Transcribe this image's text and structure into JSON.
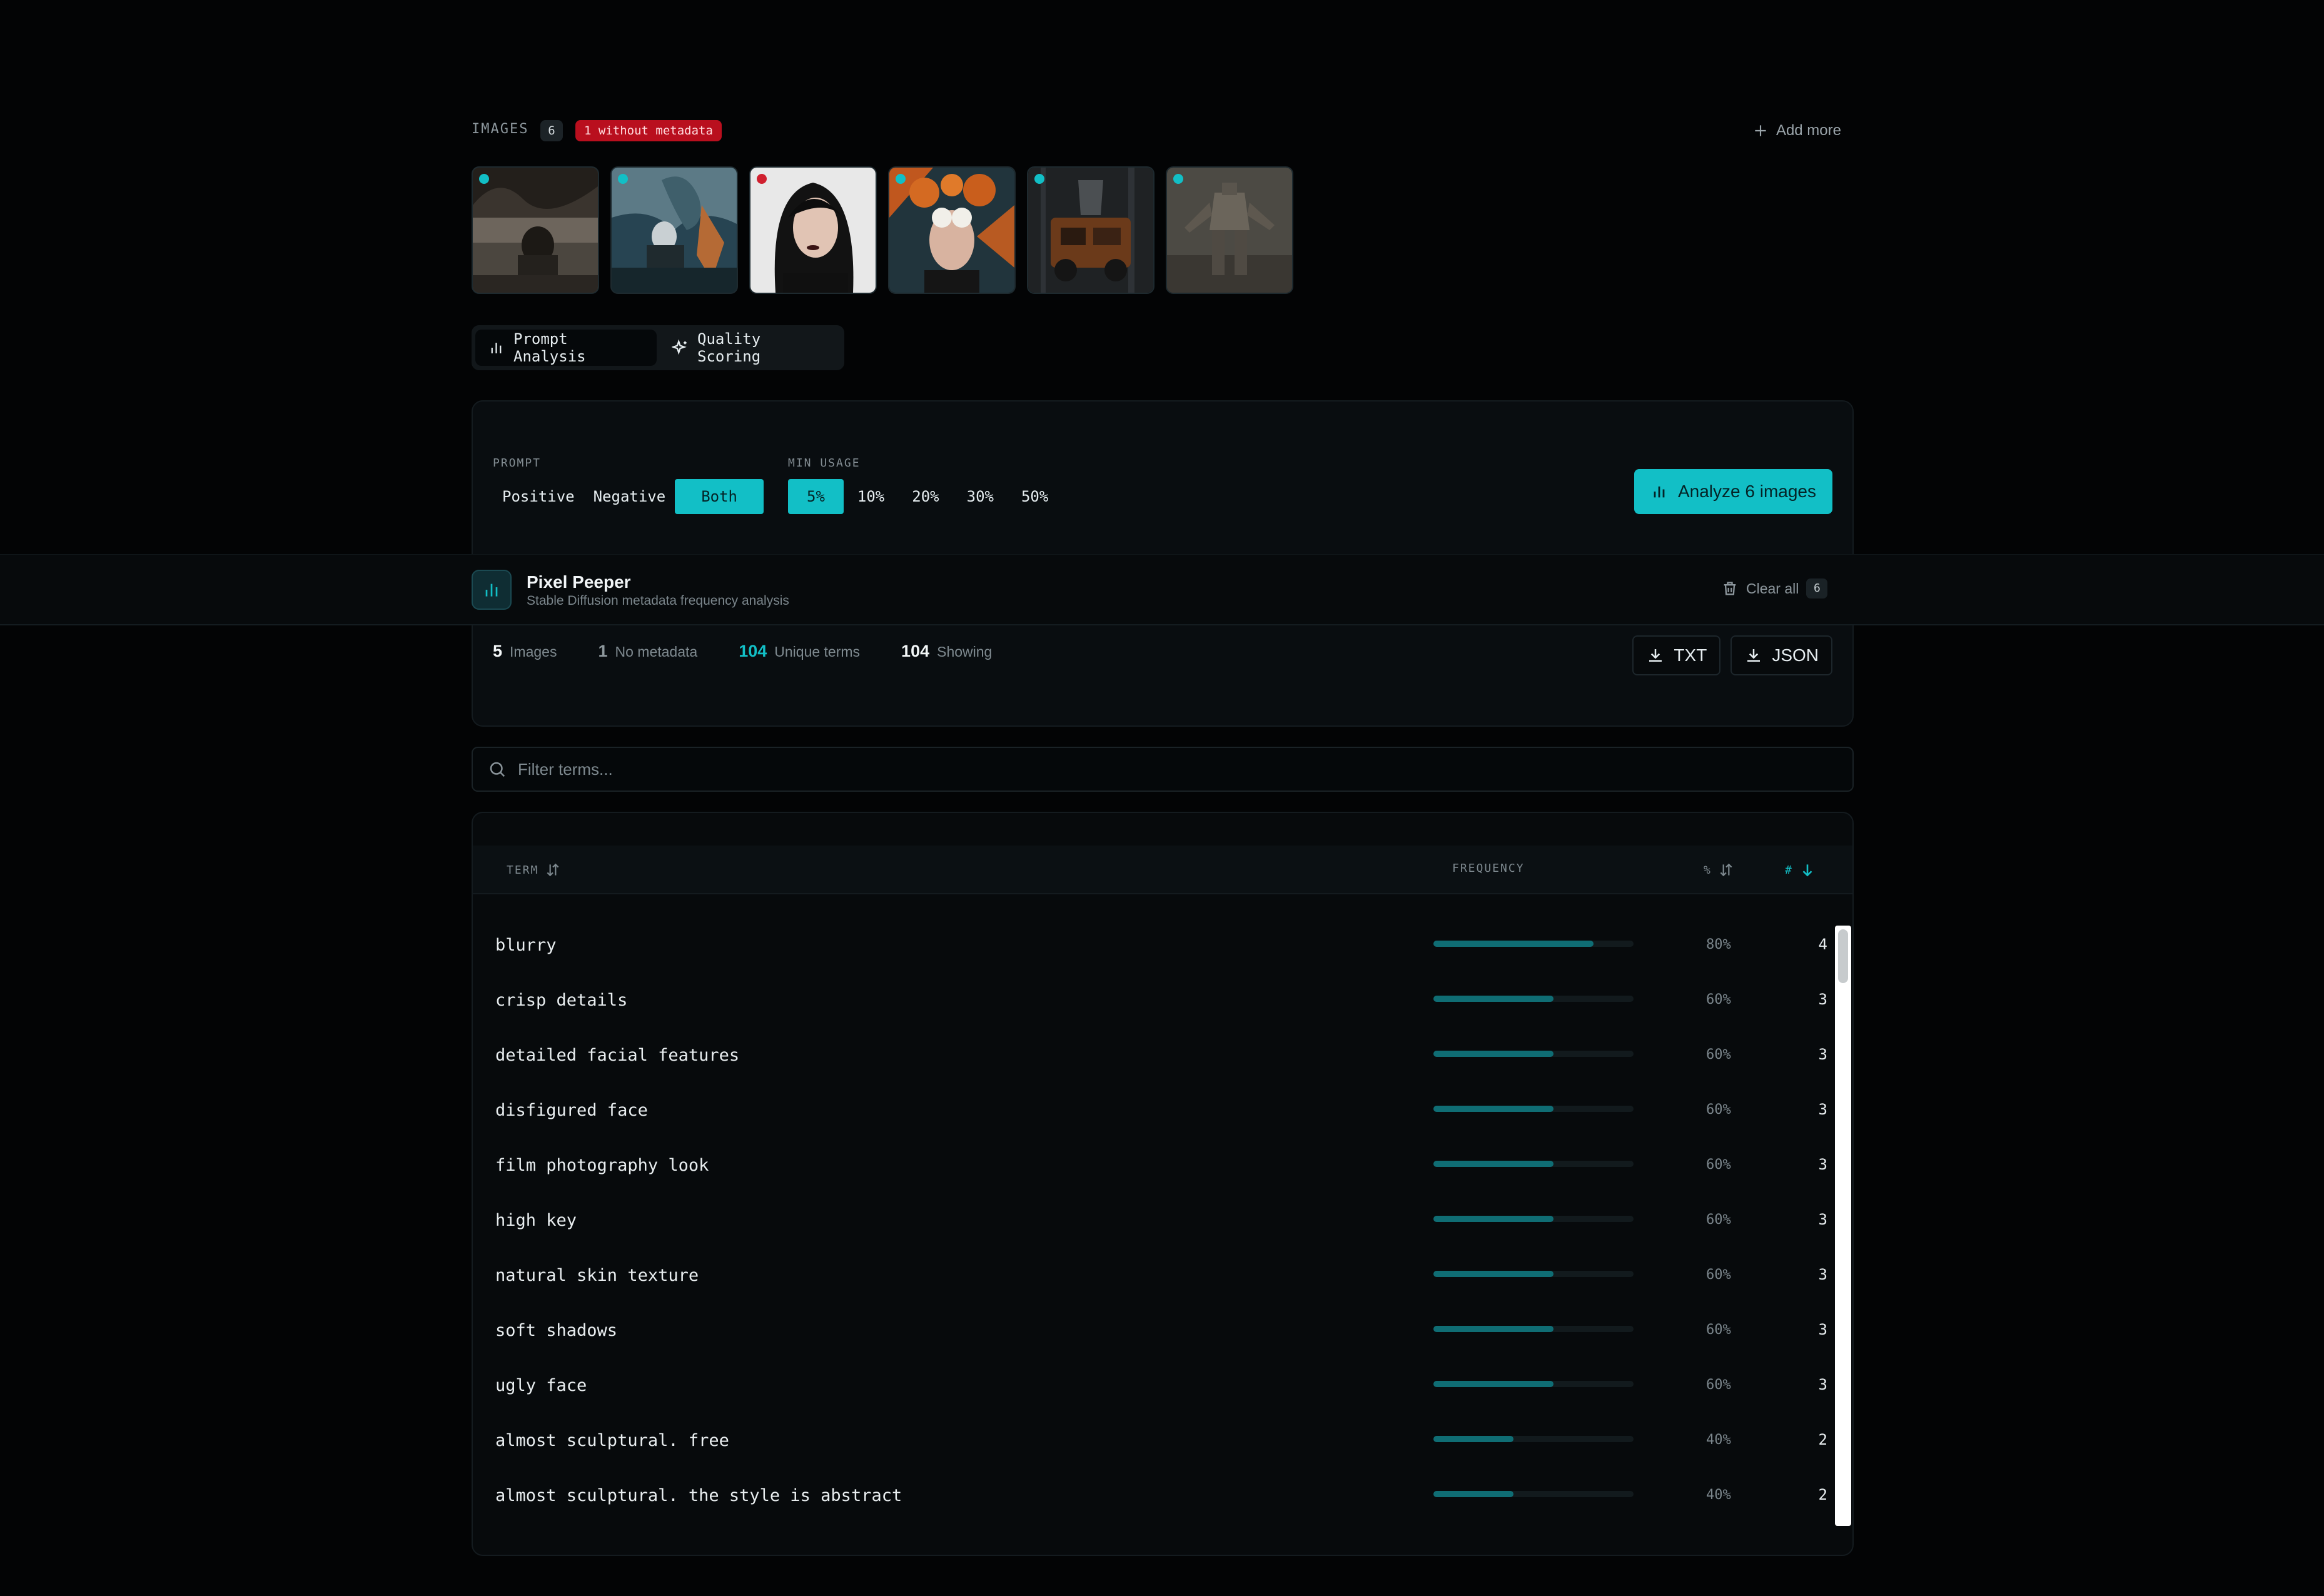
{
  "images": {
    "label": "IMAGES",
    "count": "6",
    "no_metadata_badge": "1 without metadata",
    "add_more": "Add more",
    "thumbnails": [
      {
        "name": "woman-by-lake",
        "has_metadata": true
      },
      {
        "name": "dragon-sea-warrior",
        "has_metadata": true
      },
      {
        "name": "woman-portrait",
        "has_metadata": false
      },
      {
        "name": "flower-face-woman",
        "has_metadata": true
      },
      {
        "name": "rusted-vehicle",
        "has_metadata": true
      },
      {
        "name": "robot-mech",
        "has_metadata": true
      }
    ]
  },
  "tabs": [
    {
      "label": "Prompt Analysis",
      "icon": "bar-chart-icon",
      "active": true
    },
    {
      "label": "Quality Scoring",
      "icon": "sparkles-icon",
      "active": false
    }
  ],
  "controls": {
    "prompt_label": "PROMPT",
    "prompt_options": [
      "Positive",
      "Negative",
      "Both"
    ],
    "prompt_selected": "Both",
    "min_usage_label": "MIN USAGE",
    "min_usage_options": [
      "5%",
      "10%",
      "20%",
      "30%",
      "50%"
    ],
    "min_usage_selected": "5%",
    "analyze_label": "Analyze 6 images"
  },
  "app": {
    "title": "Pixel Peeper",
    "subtitle": "Stable Diffusion metadata frequency analysis",
    "clear_all": "Clear all",
    "clear_count": "6"
  },
  "stats": {
    "images_num": "5",
    "images_label": "Images",
    "nometa_num": "1",
    "nometa_label": "No metadata",
    "unique_num": "104",
    "unique_label": "Unique terms",
    "showing_num": "104",
    "showing_label": "Showing"
  },
  "exports": {
    "txt": "TXT",
    "json": "JSON"
  },
  "filter": {
    "placeholder": "Filter terms..."
  },
  "table": {
    "headers": {
      "term": "TERM",
      "frequency": "FREQUENCY",
      "percent": "%",
      "count": "#"
    },
    "rows": [
      {
        "term": "blurry",
        "freq": 0.8,
        "pct": "80%",
        "count": "4"
      },
      {
        "term": "crisp details",
        "freq": 0.6,
        "pct": "60%",
        "count": "3"
      },
      {
        "term": "detailed facial features",
        "freq": 0.6,
        "pct": "60%",
        "count": "3"
      },
      {
        "term": "disfigured face",
        "freq": 0.6,
        "pct": "60%",
        "count": "3"
      },
      {
        "term": "film photography look",
        "freq": 0.6,
        "pct": "60%",
        "count": "3"
      },
      {
        "term": "high key",
        "freq": 0.6,
        "pct": "60%",
        "count": "3"
      },
      {
        "term": "natural skin texture",
        "freq": 0.6,
        "pct": "60%",
        "count": "3"
      },
      {
        "term": "soft shadows",
        "freq": 0.6,
        "pct": "60%",
        "count": "3"
      },
      {
        "term": "ugly face",
        "freq": 0.6,
        "pct": "60%",
        "count": "3"
      },
      {
        "term": "almost sculptural. free",
        "freq": 0.4,
        "pct": "40%",
        "count": "2"
      },
      {
        "term": "almost sculptural. the style is abstract",
        "freq": 0.4,
        "pct": "40%",
        "count": "2"
      }
    ]
  },
  "colors": {
    "accent": "#12bfc6",
    "danger": "#b90f1e",
    "bar": "#0f6d74",
    "background": "#030405"
  }
}
